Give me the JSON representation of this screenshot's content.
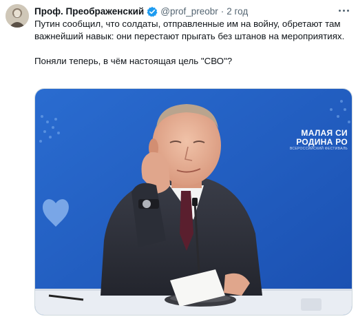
{
  "tweet": {
    "display_name": "Проф. Преображенский",
    "handle": "@prof_preobr",
    "separator": "·",
    "time": "2 год",
    "text_line1": "Путин сообщил, что солдаты, отправленные им на войну, обретают там важнейший навык: они перестают прыгать без штанов на мероприятиях.",
    "text_line2": "Поняли теперь, в чём настоящая цель \"СВО\"?",
    "verified_icon": "verified-badge-icon",
    "more_icon": "more-options-icon"
  },
  "media": {
    "banner_line1": "МАЛАЯ",
    "banner_line2": "РОДИНА",
    "banner_right1": "СИ",
    "banner_right2": "РО",
    "banner_sub": "ВСЕРОССИЙСКИЙ ФЕСТИВАЛЬ",
    "background_color": "#1f5cc0",
    "accent_color": "#1d9bf0"
  }
}
